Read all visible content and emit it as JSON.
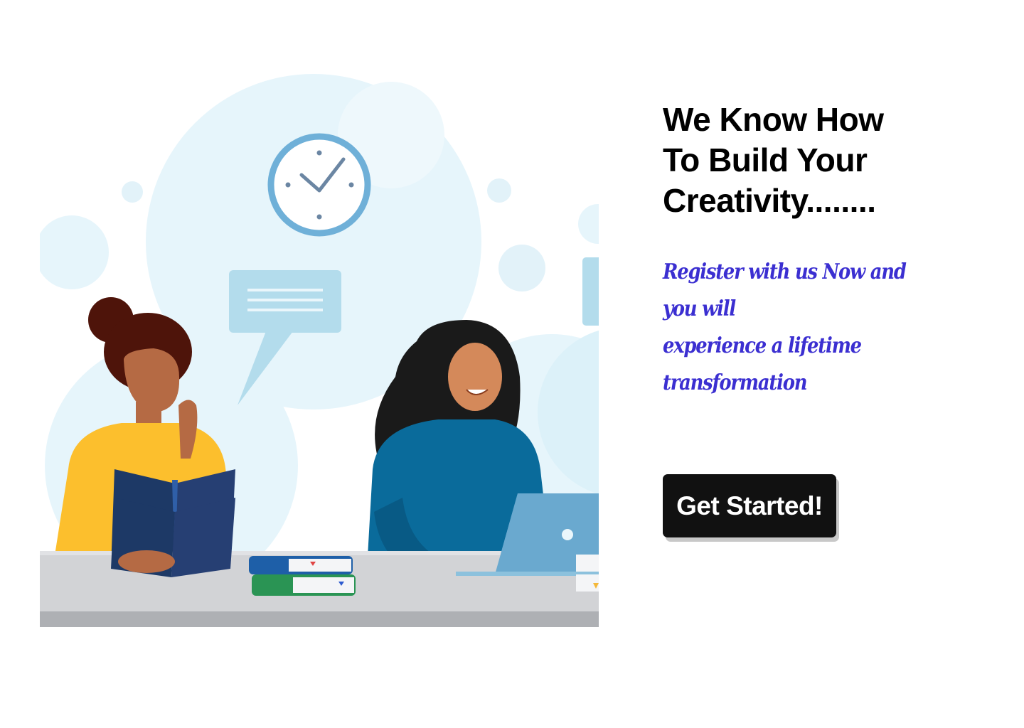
{
  "hero": {
    "headline_lines": [
      "We Know How",
      "To Build Your",
      "Creativity........"
    ],
    "tagline_lines": [
      "Register with us Now and",
      "you will",
      "experience a lifetime",
      "transformation"
    ],
    "cta_label": "Get Started!"
  },
  "illustration": {
    "alt": "two-women-studying-illustration",
    "icons": [
      "clock-icon",
      "speech-bubble-icon",
      "laptop-icon",
      "open-book-icon",
      "book-stack-icon"
    ]
  },
  "colors": {
    "headline": "#000000",
    "tagline": "#3b2fd1",
    "button_bg": "#111111",
    "button_text": "#ffffff",
    "bubble_bg": "#e6f5fb"
  }
}
